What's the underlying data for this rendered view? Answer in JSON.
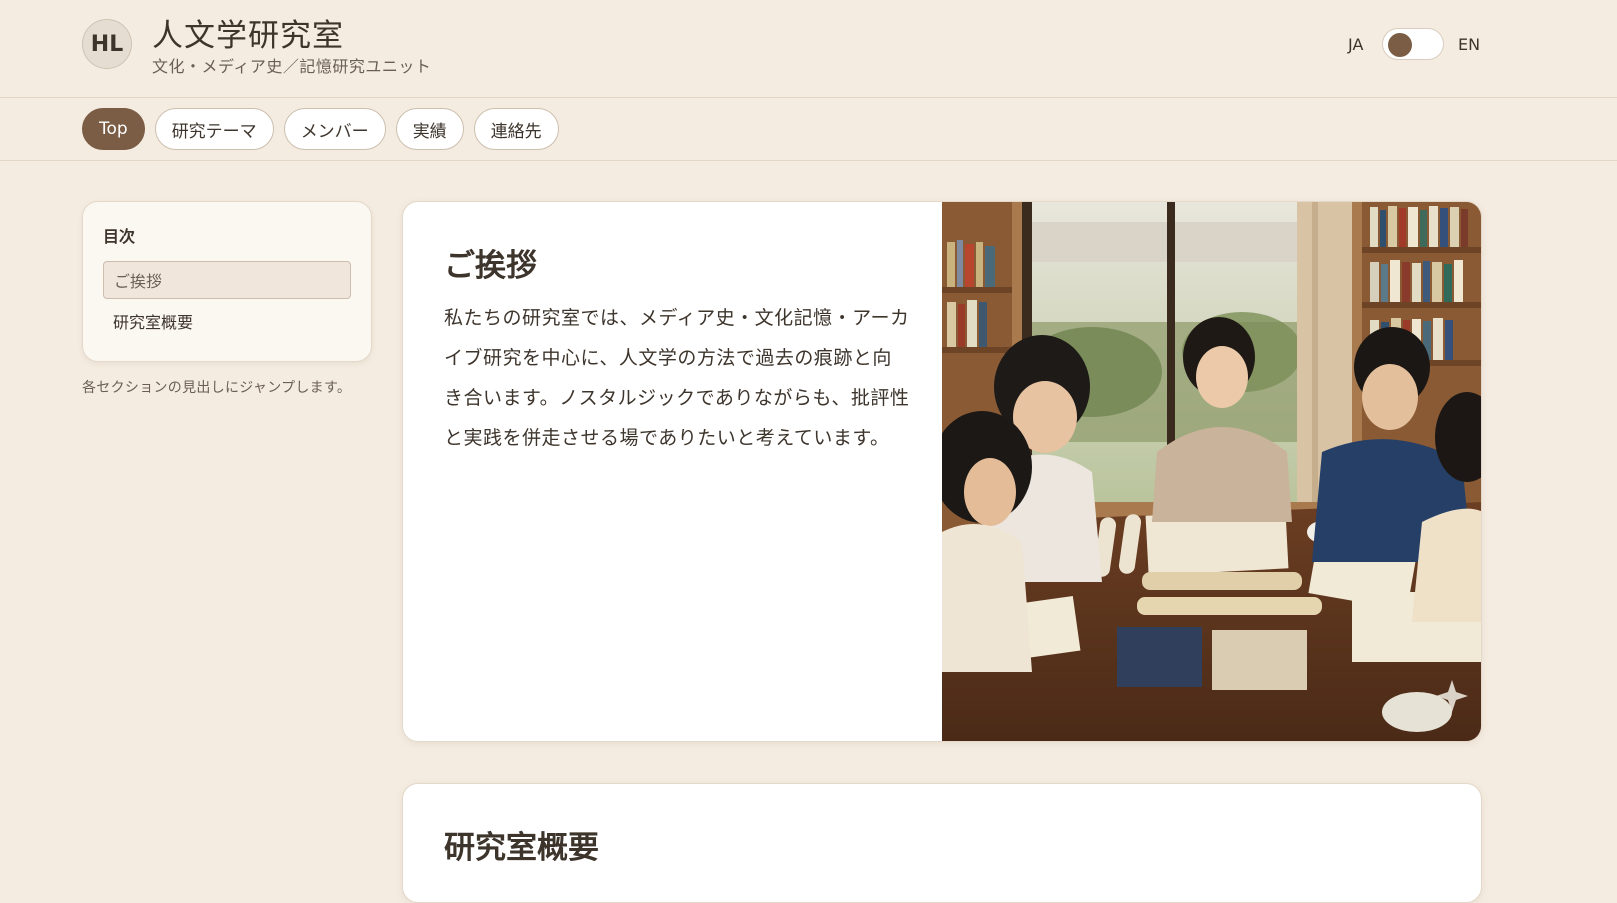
{
  "header": {
    "logo_text": "HL",
    "title": "人文学研究室",
    "subtitle": "文化・メディア史／記憶研究ユニット",
    "lang_left": "JA",
    "lang_right": "EN"
  },
  "nav": {
    "tabs": [
      {
        "label": "Top",
        "active": true
      },
      {
        "label": "研究テーマ",
        "active": false
      },
      {
        "label": "メンバー",
        "active": false
      },
      {
        "label": "実績",
        "active": false
      },
      {
        "label": "連絡先",
        "active": false
      }
    ]
  },
  "toc": {
    "title": "目次",
    "items": [
      {
        "label": "ご挨拶",
        "active": true
      },
      {
        "label": "研究室概要",
        "active": false
      }
    ],
    "note": "各セクションの見出しにジャンプします。"
  },
  "greeting": {
    "heading": "ご挨拶",
    "body": "私たちの研究室では、メディア史・文化記憶・アーカイブ研究を中心に、人文学の方法で過去の痕跡と向き合います。ノスタルジックでありながらも、批評性と実践を併走させる場でありたいと考えています。"
  },
  "overview": {
    "heading": "研究室概要"
  },
  "colors": {
    "background": "#f5ece1",
    "accent": "#7b5d45",
    "card": "#ffffff",
    "text": "#3d342c"
  }
}
